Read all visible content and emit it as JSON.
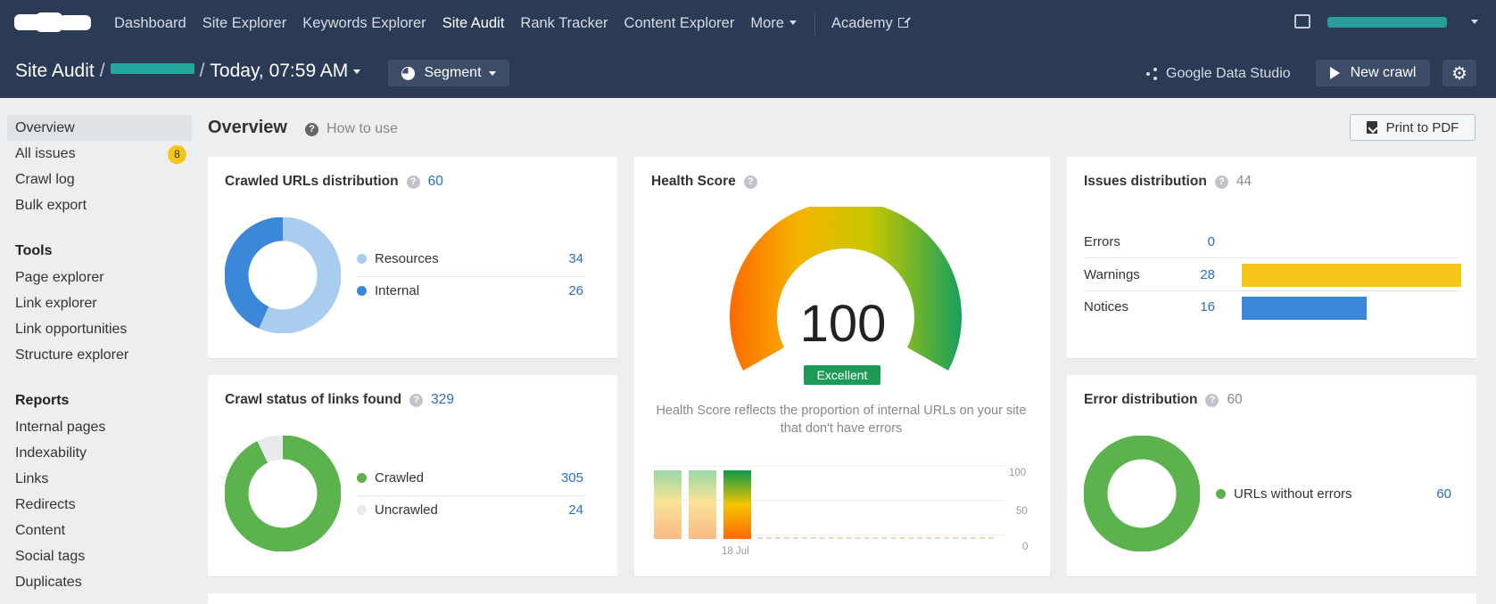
{
  "nav": {
    "links": [
      "Dashboard",
      "Site Explorer",
      "Keywords Explorer",
      "Site Audit",
      "Rank Tracker",
      "Content Explorer"
    ],
    "more": "More",
    "academy": "Academy"
  },
  "subbar": {
    "title": "Site Audit",
    "date": "Today, 07:59 AM",
    "segment": "Segment",
    "gds": "Google Data Studio",
    "new_crawl": "New crawl"
  },
  "sidebar": {
    "top": [
      {
        "label": "Overview",
        "active": true
      },
      {
        "label": "All issues",
        "badge": "8"
      },
      {
        "label": "Crawl log"
      },
      {
        "label": "Bulk export"
      }
    ],
    "tools_heading": "Tools",
    "tools": [
      "Page explorer",
      "Link explorer",
      "Link opportunities",
      "Structure explorer"
    ],
    "reports_heading": "Reports",
    "reports": [
      "Internal pages",
      "Indexability",
      "Links",
      "Redirects",
      "Content",
      "Social tags",
      "Duplicates"
    ]
  },
  "main": {
    "title": "Overview",
    "how_to": "How to use",
    "print": "Print to PDF"
  },
  "crawled": {
    "title": "Crawled URLs distribution",
    "count": "60",
    "items": [
      {
        "label": "Resources",
        "value": "34",
        "color": "#a8cdee"
      },
      {
        "label": "Internal",
        "value": "26",
        "color": "#3a88d7"
      }
    ]
  },
  "crawl_status": {
    "title": "Crawl status of links found",
    "count": "329",
    "items": [
      {
        "label": "Crawled",
        "value": "305",
        "color": "#5cb24c"
      },
      {
        "label": "Uncrawled",
        "value": "24",
        "color": "#e8eaec"
      }
    ]
  },
  "health": {
    "title": "Health Score",
    "score": "100",
    "rating": "Excellent",
    "description": "Health Score reflects the proportion of internal URLs on your site that don't have errors",
    "ticks": [
      "100",
      "50",
      "0"
    ],
    "date_label": "18 Jul"
  },
  "issues": {
    "title": "Issues distribution",
    "count": "44",
    "rows": [
      {
        "label": "Errors",
        "value": "0",
        "fraction": 0,
        "color": "#e8503a"
      },
      {
        "label": "Warnings",
        "value": "28",
        "fraction": 1,
        "color": "#f5c518"
      },
      {
        "label": "Notices",
        "value": "16",
        "fraction": 0.571,
        "color": "#3a88d7"
      }
    ]
  },
  "errors": {
    "title": "Error distribution",
    "count": "60",
    "items": [
      {
        "label": "URLs without errors",
        "value": "60",
        "color": "#5cb24c"
      }
    ]
  }
}
